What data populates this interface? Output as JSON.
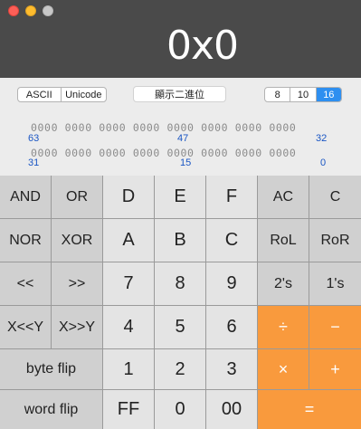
{
  "window": {
    "display_value": "0x0"
  },
  "controls": {
    "text_mode": [
      "ASCII",
      "Unicode"
    ],
    "show_binary_label": "顯示二進位",
    "bases": [
      "8",
      "10",
      "16"
    ],
    "selected_base": "16"
  },
  "binary": {
    "row1_bits": "0000 0000 0000 0000 0000 0000 0000 0000",
    "row2_bits": "0000 0000 0000 0000 0000 0000 0000 0000",
    "row1_markers": [
      "63",
      "47",
      "32"
    ],
    "row2_markers": [
      "31",
      "15",
      "0"
    ]
  },
  "keys": {
    "and": "AND",
    "or": "OR",
    "d": "D",
    "e": "E",
    "f": "F",
    "ac": "AC",
    "c": "C",
    "nor": "NOR",
    "xor": "XOR",
    "a": "A",
    "b": "B",
    "c_hex": "C",
    "rol": "RoL",
    "ror": "RoR",
    "shl": "<<",
    "shr": ">>",
    "seven": "7",
    "eight": "8",
    "nine": "9",
    "twos": "2's",
    "ones": "1's",
    "xshly": "X<<Y",
    "xshry": "X>>Y",
    "four": "4",
    "five": "5",
    "six": "6",
    "divide": "÷",
    "minus": "−",
    "byteflip": "byte flip",
    "one": "1",
    "two": "2",
    "three": "3",
    "times": "×",
    "plus": "+",
    "wordflip": "word flip",
    "ff": "FF",
    "zero": "0",
    "double_zero": "00",
    "equals": "="
  },
  "colors": {
    "display_bg": "#4a4a4a",
    "operator_orange": "#f99a3d",
    "selected_base_blue": "#2e8ff0"
  }
}
